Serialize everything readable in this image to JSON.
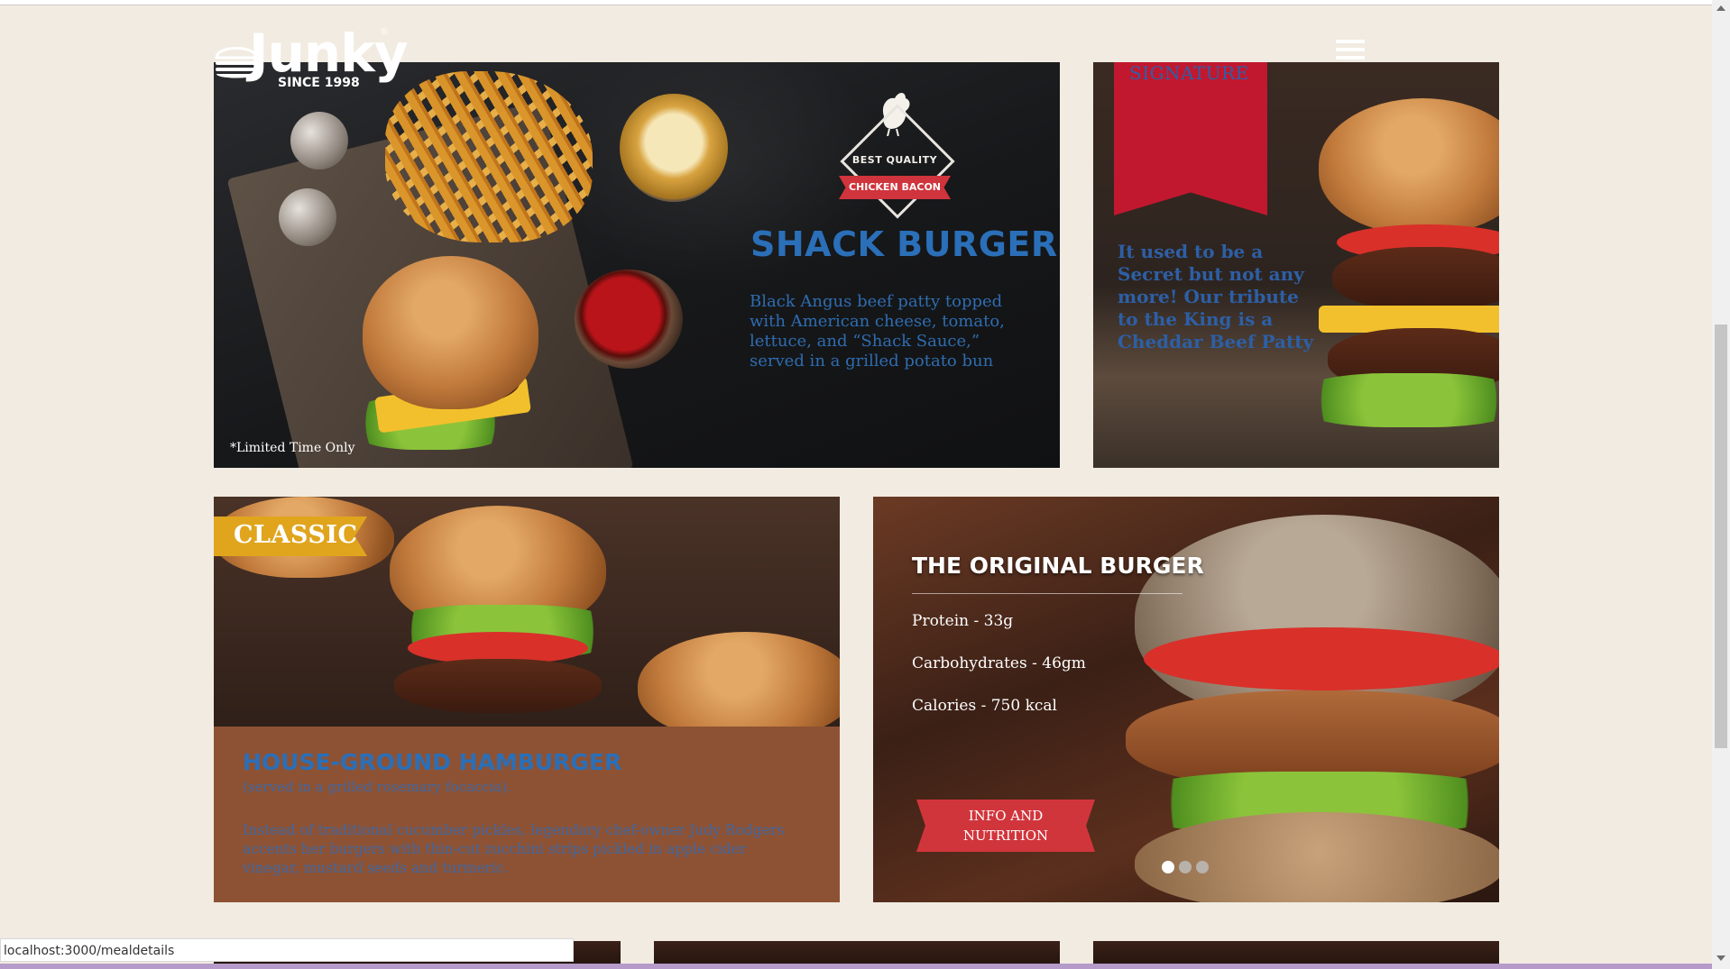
{
  "header": {
    "logo_text": "Junky",
    "logo_since": "SINCE 1998",
    "logo_reg": "®"
  },
  "shack": {
    "badge_quality": "BEST QUALITY",
    "badge_ribbon": "CHICKEN BACON",
    "title": "SHACK BURGER",
    "description": "Black Angus beef patty topped with American cheese, tomato, lettuce, and “Shack Sauce,” served in a grilled potato bun",
    "note": "*Limited Time Only"
  },
  "signature": {
    "label": "SIGNATURE",
    "text": "It used to be a Secret but not any more! Our tribute to the King is a Cheddar Beef Patty"
  },
  "classic": {
    "tag": "CLASSIC",
    "title": "HOUSE-GROUND HAMBURGER",
    "subtitle": "(served in a grilled rosemary focaccia).",
    "description": "Instead of traditional cucumber pickles, legendary chef-owner Judy Rodgers accents her burgers with thin-cut zucchini strips pickled in apple cider vinegar, mustard seeds and turmeric."
  },
  "original": {
    "title": "THE ORIGINAL BURGER",
    "nutrition": [
      "Protein - 33g",
      "Carbohydrates - 46gm",
      "Calories - 750 kcal"
    ],
    "button_label": "INFO AND NUTRITION",
    "carousel_dots": 3,
    "carousel_active": 0
  },
  "status": {
    "url": "localhost:3000/mealdetails"
  },
  "colors": {
    "background": "#f1ebe1",
    "accent_blue": "#2a6fb8",
    "accent_red": "#d1353c",
    "classic_gold": "#e0a51d",
    "signature_red": "#c1182f"
  }
}
